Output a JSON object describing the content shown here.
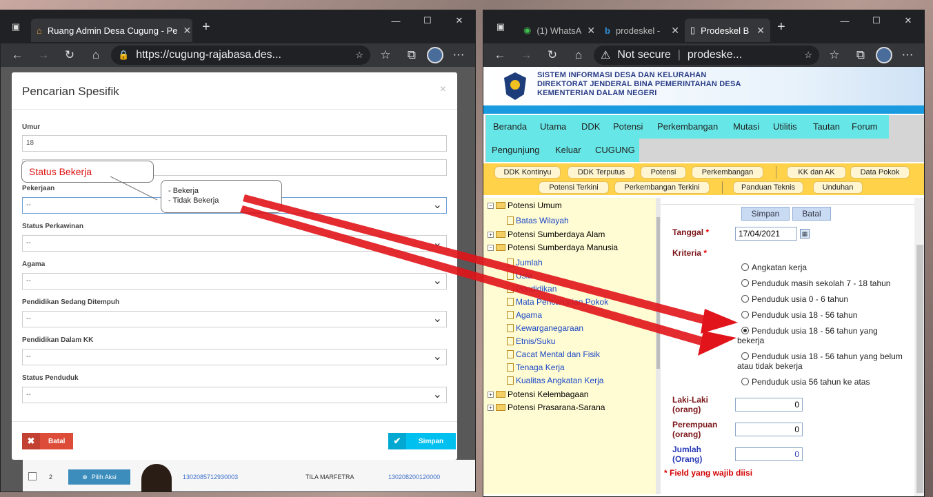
{
  "left_window": {
    "tab_title": "Ruang Admin Desa Cugung - Pe",
    "url": "https://cugung-rajabasa.des...",
    "modal": {
      "title": "Pencarian Spesifik",
      "close": "×",
      "fields": [
        {
          "label": "Umur",
          "value": "18",
          "type": "text"
        },
        {
          "label": "",
          "value": "",
          "type": "text"
        },
        {
          "label": "Pekerjaan",
          "value": "--",
          "type": "select"
        },
        {
          "label": "Status Perkawinan",
          "value": "--",
          "type": "select"
        },
        {
          "label": "Agama",
          "value": "--",
          "type": "select"
        },
        {
          "label": "Pendidikan Sedang Ditempuh",
          "value": "--",
          "type": "select"
        },
        {
          "label": "Pendidikan Dalam KK",
          "value": "--",
          "type": "select"
        },
        {
          "label": "Status Penduduk",
          "value": "--",
          "type": "select"
        }
      ],
      "cancel_label": "Batal",
      "save_label": "Simpan"
    },
    "callout_status": "Status Bekerja",
    "callout_options": [
      "- Bekerja",
      "- Tidak Bekerja"
    ],
    "table_row": {
      "no": "2",
      "action": "Pilih Aksi",
      "nik": "1302085712930003",
      "name": "TILA MARFETRA",
      "kk": "130208200120000"
    }
  },
  "right_window": {
    "tabs": [
      {
        "title": "(1) WhatsA"
      },
      {
        "title": "prodeskel -"
      },
      {
        "title": "Prodeskel B"
      }
    ],
    "security": "Not secure",
    "url": "prodeske...",
    "banner": {
      "line1": "SISTEM INFORMASI DESA DAN KELURAHAN",
      "line2": "DIREKTORAT JENDERAL BINA PEMERINTAHAN DESA",
      "line3": "KEMENTERIAN DALAM NEGERI"
    },
    "menu_row1": [
      "Beranda",
      "Utama",
      "DDK",
      "Potensi",
      "Perkembangan",
      "Mutasi",
      "Utilitis",
      "Tautan",
      "Forum"
    ],
    "menu_row2": [
      "Pengunjung",
      "Keluar",
      "CUGUNG"
    ],
    "sub_row1": [
      "DDK Kontinyu",
      "DDK Terputus",
      "Potensi",
      "Perkembangan",
      "KK dan AK",
      "Data Pokok"
    ],
    "sub_row2": [
      "Potensi Terkini",
      "Perkembangan Terkini",
      "Panduan Teknis",
      "Unduhan"
    ],
    "tree": {
      "potensi_umum": "Potensi Umum",
      "batas_wilayah": "Batas Wilayah",
      "sda": "Potensi Sumberdaya Alam",
      "sdm": "Potensi Sumberdaya Manusia",
      "sdm_items": [
        "Jumlah",
        "Usia",
        "Pendidikan",
        "Mata Pencaharian Pokok",
        "Agama",
        "Kewarganegaraan",
        "Etnis/Suku",
        "Cacat Mental dan Fisik",
        "Tenaga Kerja",
        "Kualitas Angkatan Kerja"
      ],
      "kelembagaan": "Potensi Kelembagaan",
      "prasarana": "Potensi Prasarana-Sarana"
    },
    "form": {
      "save": "Simpan",
      "cancel": "Batal",
      "tanggal_label": "Tanggal",
      "tanggal_value": "17/04/2021",
      "kriteria_label": "Kriteria",
      "required_mark": "*",
      "options": [
        "Angkatan kerja",
        "Penduduk masih sekolah 7 - 18 tahun",
        "Penduduk usia 0 - 6 tahun",
        "Penduduk usia 18 - 56 tahun",
        "Penduduk usia 18 - 56 tahun yang",
        "bekerja",
        "Penduduk usia 18 - 56 tahun yang belum",
        "atau tidak bekerja",
        "Penduduk usia 56 tahun ke atas"
      ],
      "selected_index": 4,
      "laki_label_1": "Laki-Laki",
      "laki_label_2": "(orang)",
      "laki_value": "0",
      "perempuan_label_1": "Perempuan",
      "perempuan_label_2": "(orang)",
      "perempuan_value": "0",
      "jumlah_label_1": "Jumlah",
      "jumlah_label_2": "(Orang)",
      "jumlah_value": "0",
      "note": "* Field yang wajib diisi"
    }
  },
  "colors": {
    "danger": "#dd4b39",
    "info": "#00c0ef",
    "arrow": "#e0141a",
    "menu_cyan": "#66e6e6",
    "sub_yellow": "#ffd24a"
  }
}
